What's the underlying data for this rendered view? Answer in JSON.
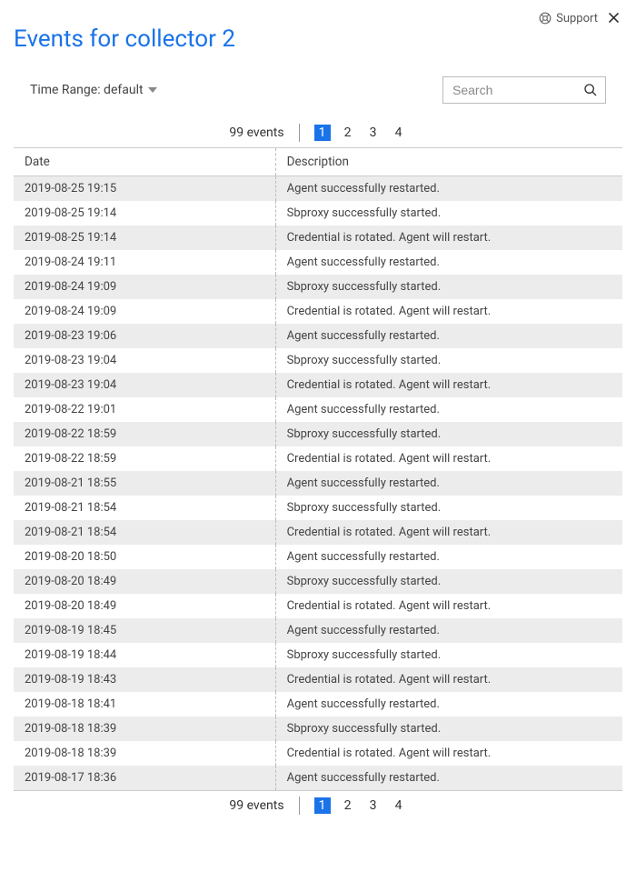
{
  "header": {
    "support_label": "Support",
    "title": "Events for collector 2"
  },
  "controls": {
    "time_range_label": "Time Range: default",
    "search_placeholder": "Search"
  },
  "pagination": {
    "count_label": "99 events",
    "pages": [
      "1",
      "2",
      "3",
      "4"
    ],
    "active": "1"
  },
  "table": {
    "headers": {
      "date": "Date",
      "description": "Description"
    },
    "rows": [
      {
        "date": "2019-08-25 19:15",
        "desc": "Agent successfully restarted."
      },
      {
        "date": "2019-08-25 19:14",
        "desc": "Sbproxy successfully started."
      },
      {
        "date": "2019-08-25 19:14",
        "desc": "Credential is rotated. Agent will restart."
      },
      {
        "date": "2019-08-24 19:11",
        "desc": "Agent successfully restarted."
      },
      {
        "date": "2019-08-24 19:09",
        "desc": "Sbproxy successfully started."
      },
      {
        "date": "2019-08-24 19:09",
        "desc": "Credential is rotated. Agent will restart."
      },
      {
        "date": "2019-08-23 19:06",
        "desc": "Agent successfully restarted."
      },
      {
        "date": "2019-08-23 19:04",
        "desc": "Sbproxy successfully started."
      },
      {
        "date": "2019-08-23 19:04",
        "desc": "Credential is rotated. Agent will restart."
      },
      {
        "date": "2019-08-22 19:01",
        "desc": "Agent successfully restarted."
      },
      {
        "date": "2019-08-22 18:59",
        "desc": "Sbproxy successfully started."
      },
      {
        "date": "2019-08-22 18:59",
        "desc": "Credential is rotated. Agent will restart."
      },
      {
        "date": "2019-08-21 18:55",
        "desc": "Agent successfully restarted."
      },
      {
        "date": "2019-08-21 18:54",
        "desc": "Sbproxy successfully started."
      },
      {
        "date": "2019-08-21 18:54",
        "desc": "Credential is rotated. Agent will restart."
      },
      {
        "date": "2019-08-20 18:50",
        "desc": "Agent successfully restarted."
      },
      {
        "date": "2019-08-20 18:49",
        "desc": "Sbproxy successfully started."
      },
      {
        "date": "2019-08-20 18:49",
        "desc": "Credential is rotated. Agent will restart."
      },
      {
        "date": "2019-08-19 18:45",
        "desc": "Agent successfully restarted."
      },
      {
        "date": "2019-08-19 18:44",
        "desc": "Sbproxy successfully started."
      },
      {
        "date": "2019-08-19 18:43",
        "desc": "Credential is rotated. Agent will restart."
      },
      {
        "date": "2019-08-18 18:41",
        "desc": "Agent successfully restarted."
      },
      {
        "date": "2019-08-18 18:39",
        "desc": "Sbproxy successfully started."
      },
      {
        "date": "2019-08-18 18:39",
        "desc": "Credential is rotated. Agent will restart."
      },
      {
        "date": "2019-08-17 18:36",
        "desc": "Agent successfully restarted."
      }
    ]
  }
}
